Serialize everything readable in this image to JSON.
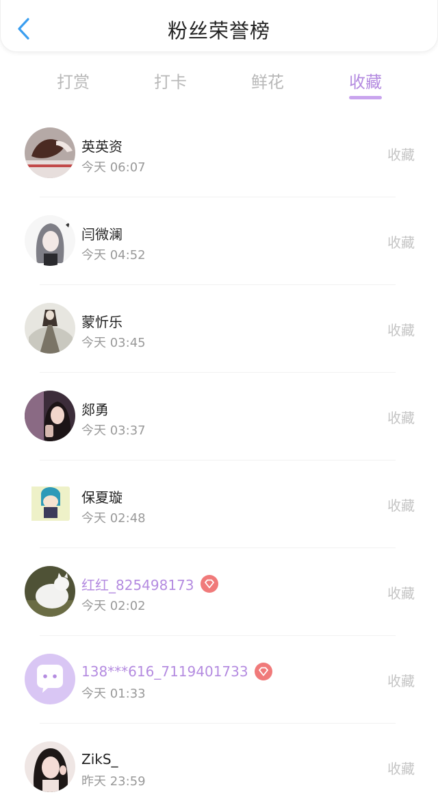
{
  "header": {
    "title": "粉丝荣誉榜"
  },
  "tabs": [
    {
      "label": "打赏"
    },
    {
      "label": "打卡"
    },
    {
      "label": "鲜花"
    },
    {
      "label": "收藏"
    }
  ],
  "active_tab": "收藏",
  "colors": {
    "accent": "#b48be0",
    "back_arrow": "#3a9ef0",
    "vip_badge": "#f07a7a"
  },
  "rows": [
    {
      "name": "英英资",
      "time": "今天 06:07",
      "action": "收藏",
      "vip": false,
      "avatar": "avatar-1-icon"
    },
    {
      "name": "闫微澜",
      "time": "今天 04:52",
      "action": "收藏",
      "vip": false,
      "avatar": "avatar-2-icon"
    },
    {
      "name": "蒙忻乐",
      "time": "今天 03:45",
      "action": "收藏",
      "vip": false,
      "avatar": "avatar-3-icon"
    },
    {
      "name": "郯勇",
      "time": "今天 03:37",
      "action": "收藏",
      "vip": false,
      "avatar": "avatar-4-icon"
    },
    {
      "name": "保夏璇",
      "time": "今天 02:48",
      "action": "收藏",
      "vip": false,
      "avatar": "avatar-5-icon"
    },
    {
      "name": "红红_825498173",
      "time": "今天 02:02",
      "action": "收藏",
      "vip": true,
      "avatar": "avatar-6-icon"
    },
    {
      "name": "138***616_7119401733",
      "time": "今天 01:33",
      "action": "收藏",
      "vip": true,
      "avatar": "chat-bubble-icon"
    },
    {
      "name": "ZikS_",
      "time": "昨天 23:59",
      "action": "收藏",
      "vip": false,
      "avatar": "avatar-8-icon"
    }
  ]
}
